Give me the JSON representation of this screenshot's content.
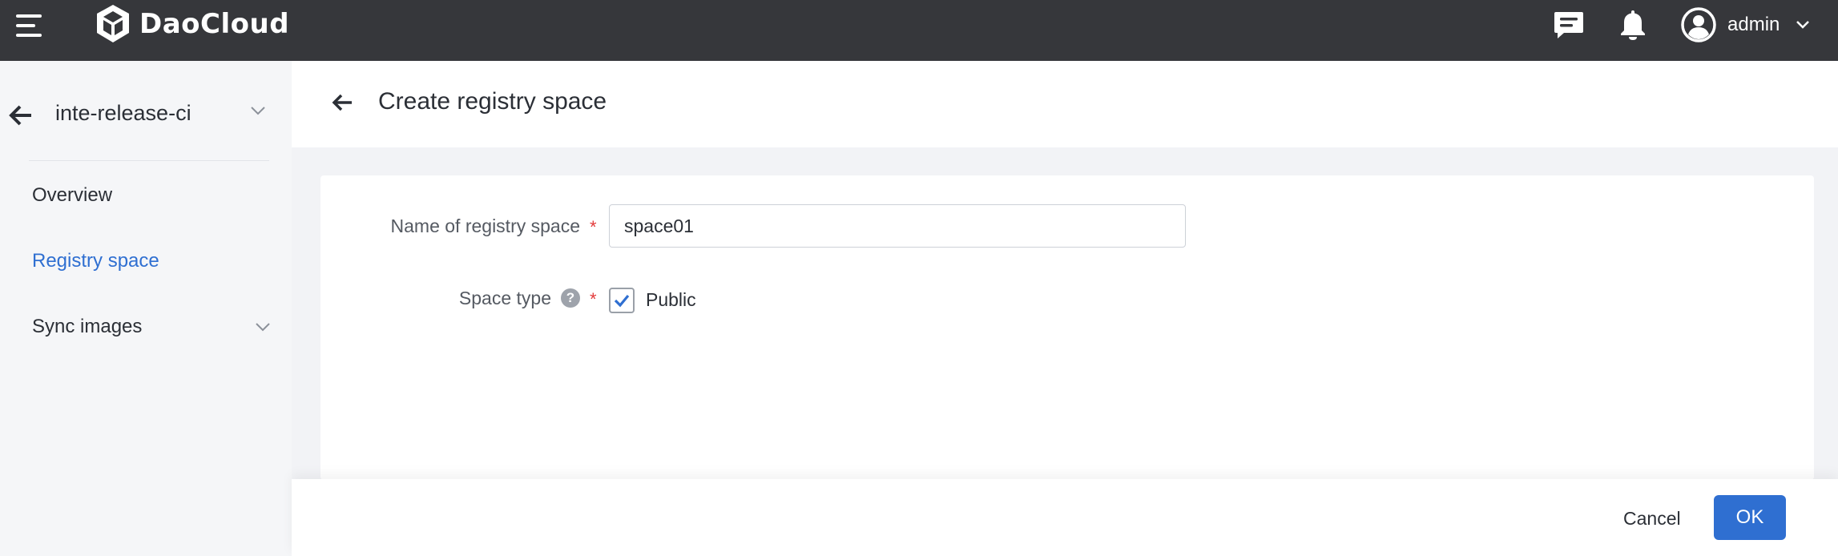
{
  "topbar": {
    "brand": "DaoCloud",
    "user_name": "admin"
  },
  "sidebar": {
    "workspace": "inte-release-ci",
    "items": [
      {
        "label": "Overview",
        "active": false
      },
      {
        "label": "Registry space",
        "active": true
      },
      {
        "label": "Sync images",
        "active": false,
        "expandable": true
      }
    ]
  },
  "header": {
    "title": "Create registry space"
  },
  "form": {
    "name_label": "Name of registry space",
    "name_value": "space01",
    "required_mark": "*",
    "type_label": "Space type",
    "help_glyph": "?",
    "public_label": "Public",
    "public_checked": true
  },
  "footer": {
    "cancel_label": "Cancel",
    "ok_label": "OK"
  },
  "colors": {
    "topbar": "#36373b",
    "accent": "#2f6fd1",
    "required": "#e33a3a"
  }
}
